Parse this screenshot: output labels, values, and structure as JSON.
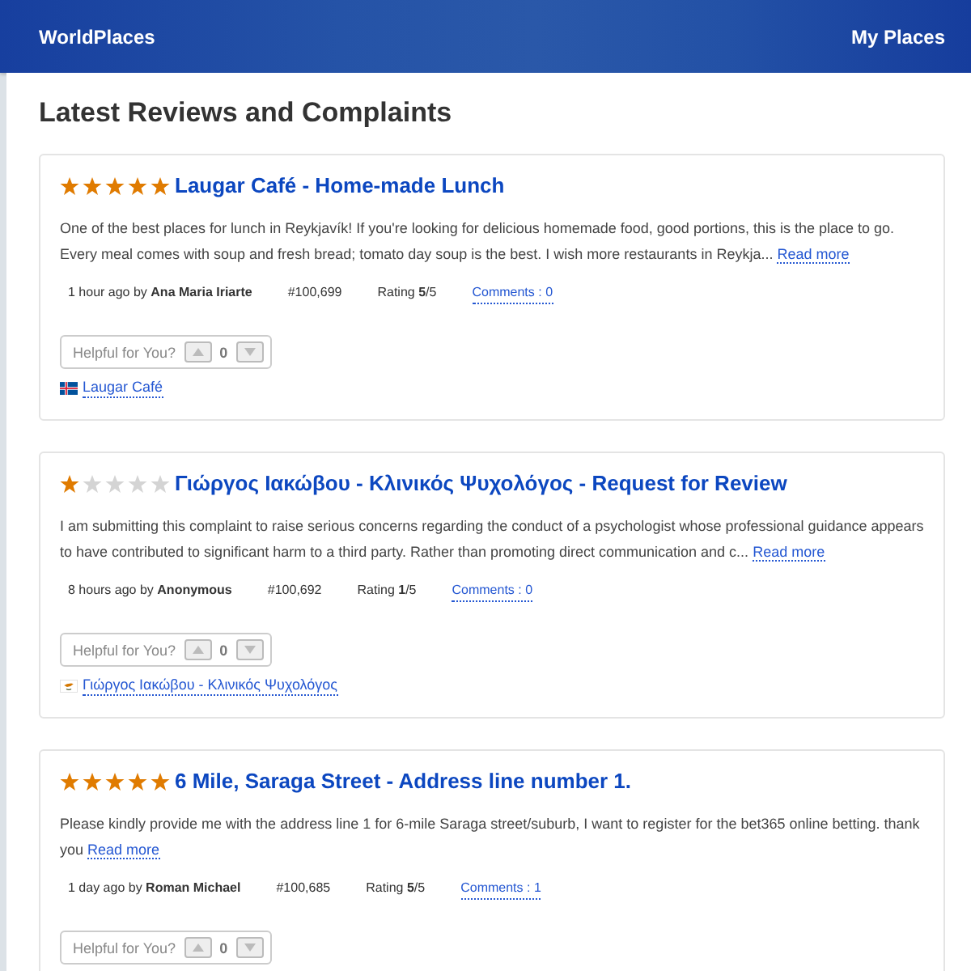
{
  "header": {
    "brand": "WorldPlaces",
    "nav": [
      {
        "label": "My Places"
      }
    ]
  },
  "page_title": "Latest Reviews and Complaints",
  "reviews": [
    {
      "stars": 5,
      "title": "Laugar Café - Home-made Lunch",
      "excerpt": "One of the best places for lunch in Reykjavík! If you're looking for delicious homemade food, good portions, this is the place to go. Every meal comes with soup and fresh bread; tomato day soup is the best. I wish more restaurants in Reykja...",
      "read_more": "Read more",
      "meta": {
        "posted": "1 hour ago by **Ana Maria Iriarte**",
        "id": "#100,699",
        "rating": "Rating **5**/5",
        "comments": "Comments : 0"
      },
      "helpful": {
        "label": "Helpful for You?",
        "count": "0"
      },
      "place": {
        "kind": "iceland",
        "name": "Laugar Café"
      }
    },
    {
      "stars": 1,
      "title": "Γιώργος Ιακώβου - Κλινικός Ψυχολόγος - Request for Review",
      "excerpt": "I am submitting this complaint to raise serious concerns regarding the conduct of a psychologist whose professional guidance appears to have contributed to significant harm to a third party. Rather than promoting direct communication and c...",
      "read_more": "Read more",
      "meta": {
        "posted": "8 hours ago by **Anonymous**",
        "id": "#100,692",
        "rating": "Rating **1**/5",
        "comments": "Comments : 0"
      },
      "helpful": {
        "label": "Helpful for You?",
        "count": "0"
      },
      "place": {
        "kind": "cyprus",
        "name": "Γιώργος Ιακώβου - Κλινικός Ψυχολόγος"
      }
    },
    {
      "stars": 5,
      "title": "6 Mile, Saraga Street - Address line number 1.",
      "excerpt": "Please kindly provide me with the address line 1 for 6-mile Saraga street/suburb, I want to register for the bet365 online betting. thank you",
      "read_more": "Read more",
      "meta": {
        "posted": "1 day ago by **Roman Michael**",
        "id": "#100,685",
        "rating": "Rating **5**/5",
        "comments": "Comments : 1"
      },
      "helpful": {
        "label": "Helpful for You?",
        "count": "0"
      }
    }
  ]
}
